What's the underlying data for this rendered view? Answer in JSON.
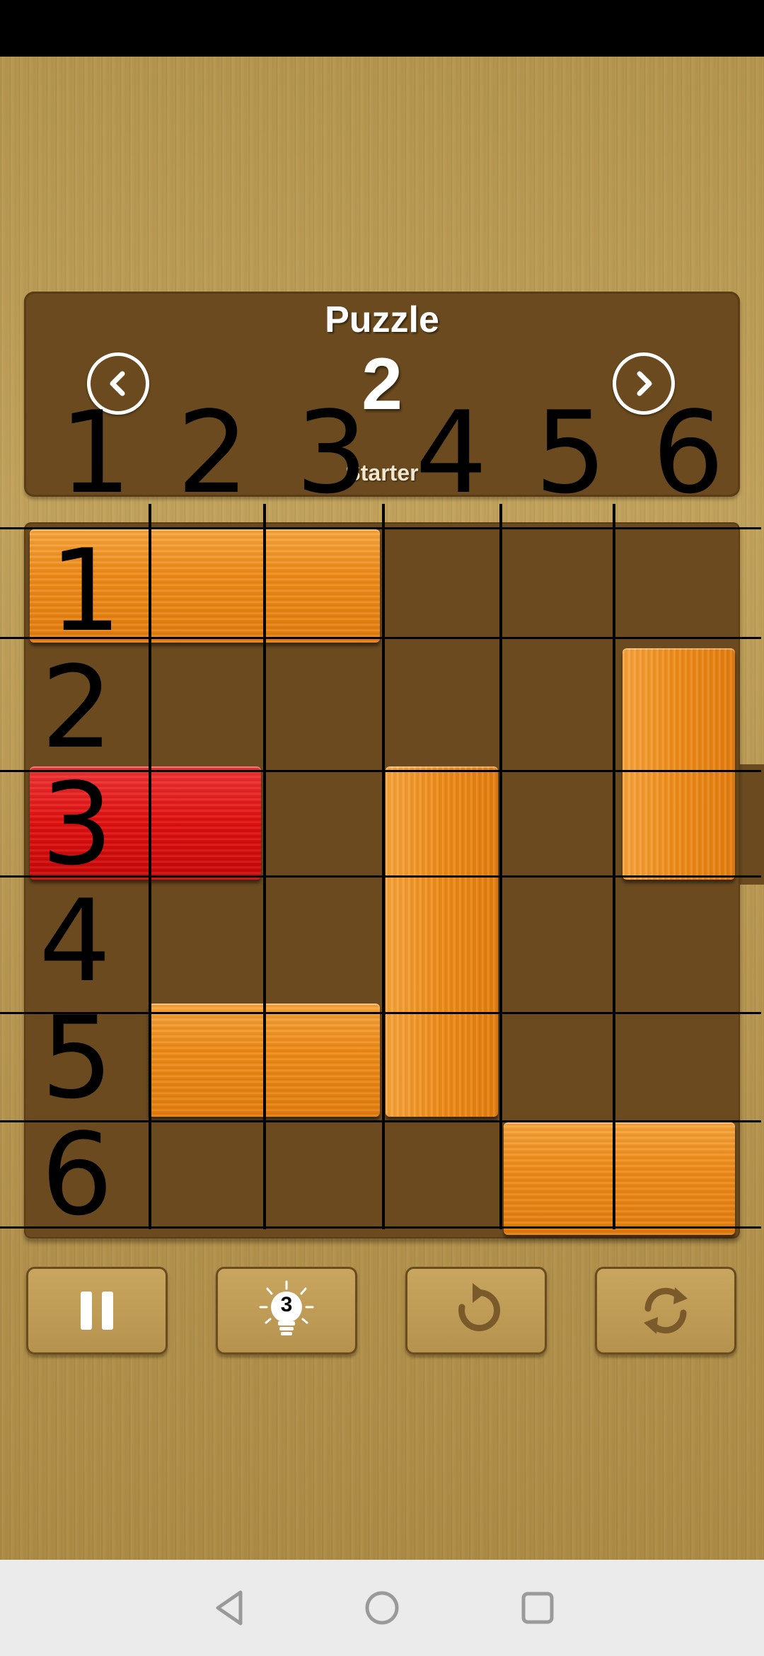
{
  "header": {
    "title": "Puzzle",
    "number": "2",
    "level": "Starter"
  },
  "column_labels": [
    "1",
    "2",
    "3",
    "4",
    "5",
    "6"
  ],
  "row_labels": [
    "1",
    "2",
    "3",
    "4",
    "5",
    "6"
  ],
  "board": {
    "size": 6,
    "blocks": [
      {
        "name": "block-row1-horizontal",
        "color": "orange",
        "row": 1,
        "col": 1,
        "length": 3,
        "orientation": "horizontal"
      },
      {
        "name": "block-col6-vertical",
        "color": "orange",
        "row": 2,
        "col": 6,
        "length": 2,
        "orientation": "vertical"
      },
      {
        "name": "target-red-block",
        "color": "red",
        "row": 3,
        "col": 1,
        "length": 2,
        "orientation": "horizontal"
      },
      {
        "name": "block-col4-vertical",
        "color": "orange",
        "row": 3,
        "col": 4,
        "length": 3,
        "orientation": "vertical"
      },
      {
        "name": "block-row5-horizontal",
        "color": "orange",
        "row": 5,
        "col": 2,
        "length": 2,
        "orientation": "horizontal"
      },
      {
        "name": "block-row6-horizontal",
        "color": "orange",
        "row": 6,
        "col": 5,
        "length": 2,
        "orientation": "horizontal"
      }
    ],
    "exit": {
      "row": 3,
      "side": "right"
    }
  },
  "controls": {
    "pause_icon": "pause-icon",
    "hint_icon": "lightbulb-icon",
    "hint_count": "3",
    "undo_icon": "undo-icon",
    "restart_icon": "restart-icon"
  },
  "colors": {
    "orange": "#ee8a16",
    "red": "#e10f0f",
    "board": "#6b4a20"
  }
}
